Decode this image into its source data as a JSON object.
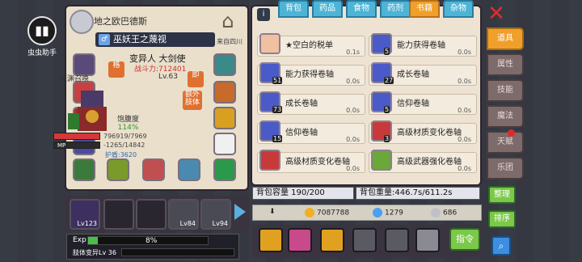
{
  "app_helper": {
    "label": "虫虫助手",
    "icon": "book-icon"
  },
  "character": {
    "name": "地之欧巴德斯",
    "title": "巫妖王之蔑视",
    "origin": "来自四川",
    "race_class": "变异人 大剑使",
    "power_label": "战斗力:712401",
    "level_left": "深渊召唤",
    "level_right": "Lv.63",
    "satiety_label": "饱腹度",
    "satiety_value": "114%",
    "hp_text": "796919/7969",
    "mp_label": "MP",
    "mp_text": "-1265/14842",
    "guard_text": "护盾:3620",
    "badge_ge": "格",
    "badge_ji": "即",
    "badge_extra": "额外肢体"
  },
  "companions": [
    {
      "level": "Lv123"
    },
    {
      "level": ""
    },
    {
      "level": ""
    },
    {
      "level": "Lv84"
    },
    {
      "level": "Lv94"
    }
  ],
  "exp": {
    "label": "Exp",
    "percent_text": "8%",
    "progress": 0.08,
    "tier_label": "肢体变异Lv 36"
  },
  "tabs": [
    {
      "label": "背包"
    },
    {
      "label": "药品"
    },
    {
      "label": "食物"
    },
    {
      "label": "药剂"
    },
    {
      "label": "书籍"
    },
    {
      "label": "杂物"
    }
  ],
  "items": [
    {
      "name": "★空白的税单",
      "time": "0.1s",
      "count": ""
    },
    {
      "name": "能力获得卷轴",
      "time": "0.0s",
      "count": "5"
    },
    {
      "name": "能力获得卷轴",
      "time": "0.0s",
      "count": "51"
    },
    {
      "name": "成长卷轴",
      "time": "0.0s",
      "count": "27"
    },
    {
      "name": "成长卷轴",
      "time": "0.0s",
      "count": "73"
    },
    {
      "name": "信仰卷轴",
      "time": "0.0s",
      "count": "5"
    },
    {
      "name": "信仰卷轴",
      "time": "0.0s",
      "count": "15"
    },
    {
      "name": "高级材质变化卷轴",
      "time": "0.0s",
      "count": "3"
    },
    {
      "name": "高级材质变化卷轴",
      "time": "0.0s",
      "count": ""
    },
    {
      "name": "高级武器强化卷轴",
      "time": "0.0s",
      "count": ""
    }
  ],
  "capacity": {
    "text": "背包容量 190/200"
  },
  "weight": {
    "text": "背包重量:446.7s/611.2s"
  },
  "currency": {
    "gold": "7087788",
    "gems": "1279",
    "silver": "686"
  },
  "command_label": "指令",
  "side_tabs": [
    {
      "label": "道具"
    },
    {
      "label": "属性"
    },
    {
      "label": "技能"
    },
    {
      "label": "魔法"
    },
    {
      "label": "天赋"
    },
    {
      "label": "乐团"
    }
  ],
  "sort_label": "整理",
  "order_label": "排序",
  "colors": {
    "accent": "#f0a02a",
    "tab": "#4db4d6",
    "panel": "#eee3d3"
  }
}
